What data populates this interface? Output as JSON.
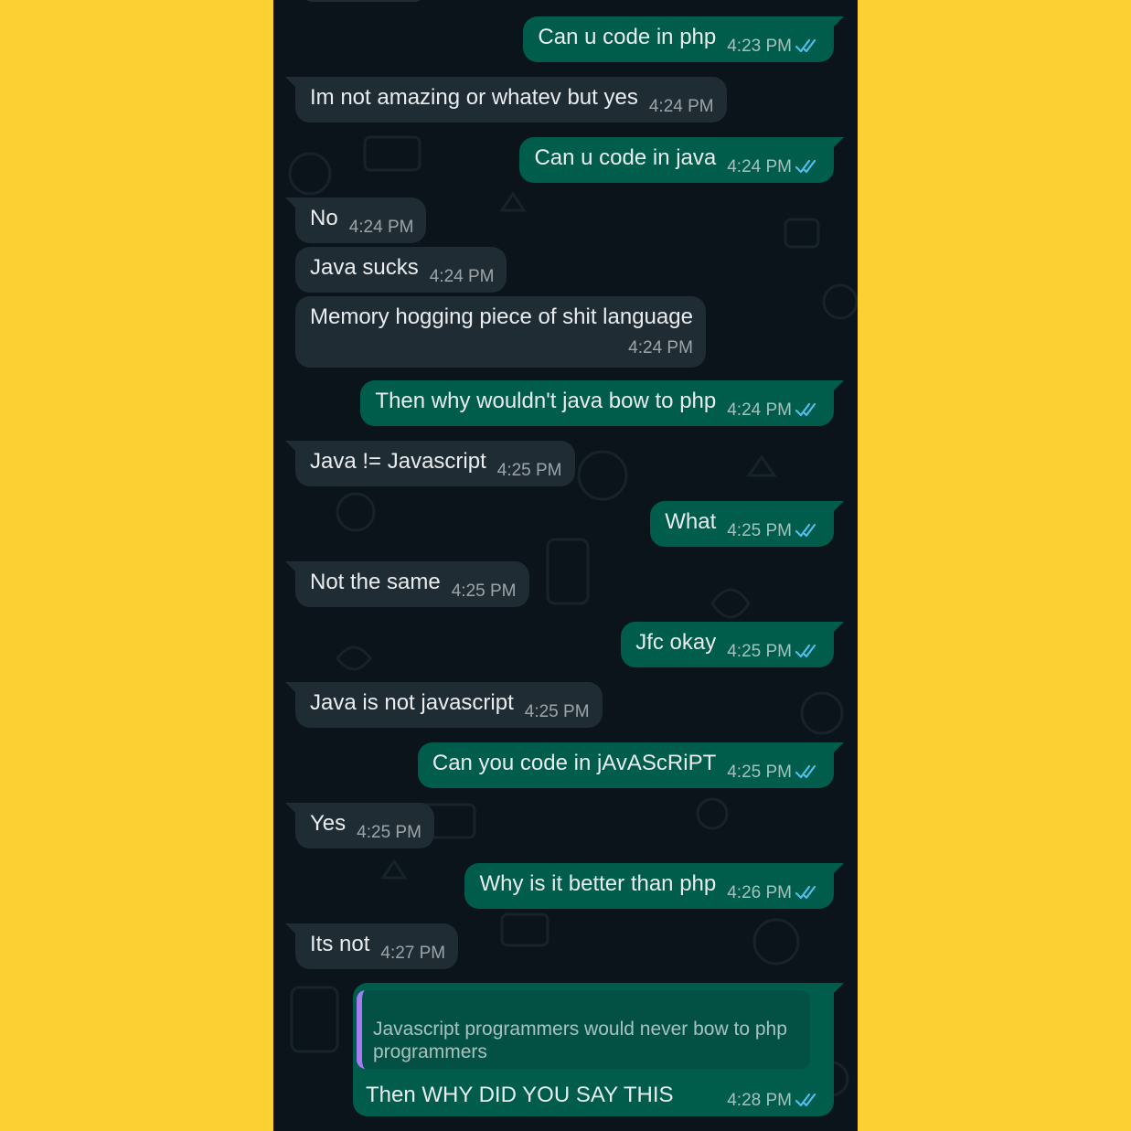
{
  "colors": {
    "page_background": "#FCCF33",
    "chat_background": "#0B141A",
    "incoming_bubble": "#202C33",
    "outgoing_bubble": "#005C4B",
    "read_ticks": "#53BDEB",
    "quote_bar": "#A47CF3"
  },
  "icons": {
    "read_receipt": "double-check-icon"
  },
  "messages": [
    {
      "direction": "outgoing",
      "text": "Can u code in php",
      "time": "4:23 PM",
      "read": true
    },
    {
      "direction": "incoming",
      "text": "Im not amazing or whatev but yes",
      "time": "4:24 PM"
    },
    {
      "direction": "outgoing",
      "text": "Can u code in java",
      "time": "4:24 PM",
      "read": true
    },
    {
      "direction": "incoming",
      "text": "No",
      "time": "4:24 PM"
    },
    {
      "direction": "incoming",
      "text": "Java sucks",
      "time": "4:24 PM"
    },
    {
      "direction": "incoming",
      "text": "Memory hogging piece of shit language",
      "time": "4:24 PM"
    },
    {
      "direction": "outgoing",
      "text": "Then why wouldn't java bow to php",
      "time": "4:24 PM",
      "read": true
    },
    {
      "direction": "incoming",
      "text": "Java != Javascript",
      "time": "4:25 PM"
    },
    {
      "direction": "outgoing",
      "text": "What",
      "time": "4:25 PM",
      "read": true
    },
    {
      "direction": "incoming",
      "text": "Not the same",
      "time": "4:25 PM"
    },
    {
      "direction": "outgoing",
      "text": "Jfc okay",
      "time": "4:25 PM",
      "read": true
    },
    {
      "direction": "incoming",
      "text": "Java is not javascript",
      "time": "4:25 PM"
    },
    {
      "direction": "outgoing",
      "text": "Can you code in jAvAScRiPT",
      "time": "4:25 PM",
      "read": true
    },
    {
      "direction": "incoming",
      "text": "Yes",
      "time": "4:25 PM"
    },
    {
      "direction": "outgoing",
      "text": "Why is it better than php",
      "time": "4:26 PM",
      "read": true
    },
    {
      "direction": "incoming",
      "text": "Its not",
      "time": "4:27 PM"
    },
    {
      "direction": "outgoing",
      "quote": "Javascript programmers would never bow to php programmers",
      "text": "Then WHY DID YOU SAY THIS",
      "time": "4:28 PM",
      "read": true
    }
  ]
}
